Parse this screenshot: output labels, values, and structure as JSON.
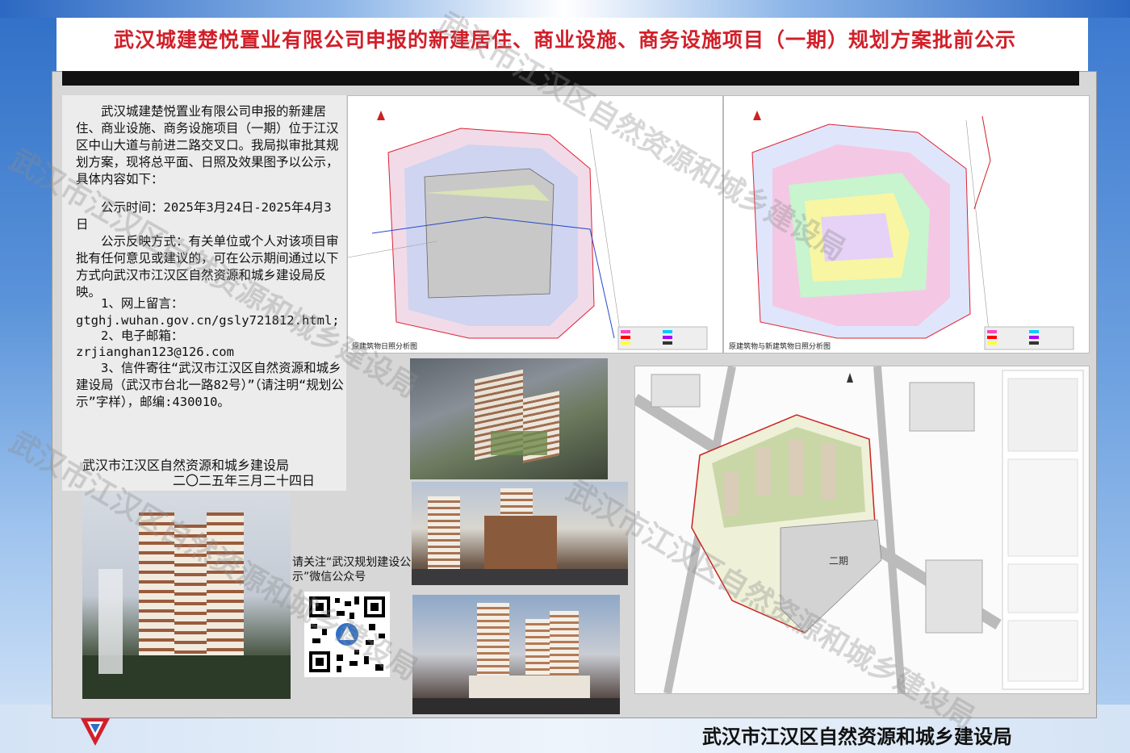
{
  "header": {
    "title": "武汉城建楚悦置业有限公司申报的新建居住、商业设施、商务设施项目（一期）规划方案批前公示"
  },
  "notice": {
    "intro": "武汉城建楚悦置业有限公司申报的新建居住、商业设施、商务设施项目（一期）位于江汉区中山大道与前进二路交叉口。我局拟审批其规划方案，现将总平面、日照及效果图予以公示，具体内容如下：",
    "period": "公示时间：2025年3月24日-2025年4月3日",
    "feedback": "公示反映方式：有关单位或个人对该项目审批有任何意见或建议的，可在公示期间通过以下方式向武汉市江汉区自然资源和城乡建设局反映。",
    "item1_label": "1、网上留言：",
    "item1_value": "gtghj.wuhan.gov.cn/gsly721812.html;",
    "item2_label": "2、电子邮箱：",
    "item2_value": "zrjianghan123@126.com",
    "item3": "3、信件寄往“武汉市江汉区自然资源和城乡建设局（武汉市台北一路82号）”（请注明“规划公示”字样），邮编:430010。"
  },
  "signature": {
    "bureau": "武汉市江汉区自然资源和城乡建设局",
    "date": "二〇二五年三月二十四日"
  },
  "qr": {
    "label": "请关注“武汉规划建设公示”微信公众号"
  },
  "maps": {
    "left_caption": "原建筑物日照分析图",
    "right_caption": "原建筑物与新建筑物日照分析图",
    "site_label_phase2": "二期"
  },
  "footer": {
    "bureau": "武汉市江汉区自然资源和城乡建设局"
  },
  "watermark": {
    "text": "武汉市江汉区自然资源和城乡建设局"
  },
  "colors": {
    "title_red": "#d1202a",
    "frame_blue": "#2f6fc7"
  }
}
